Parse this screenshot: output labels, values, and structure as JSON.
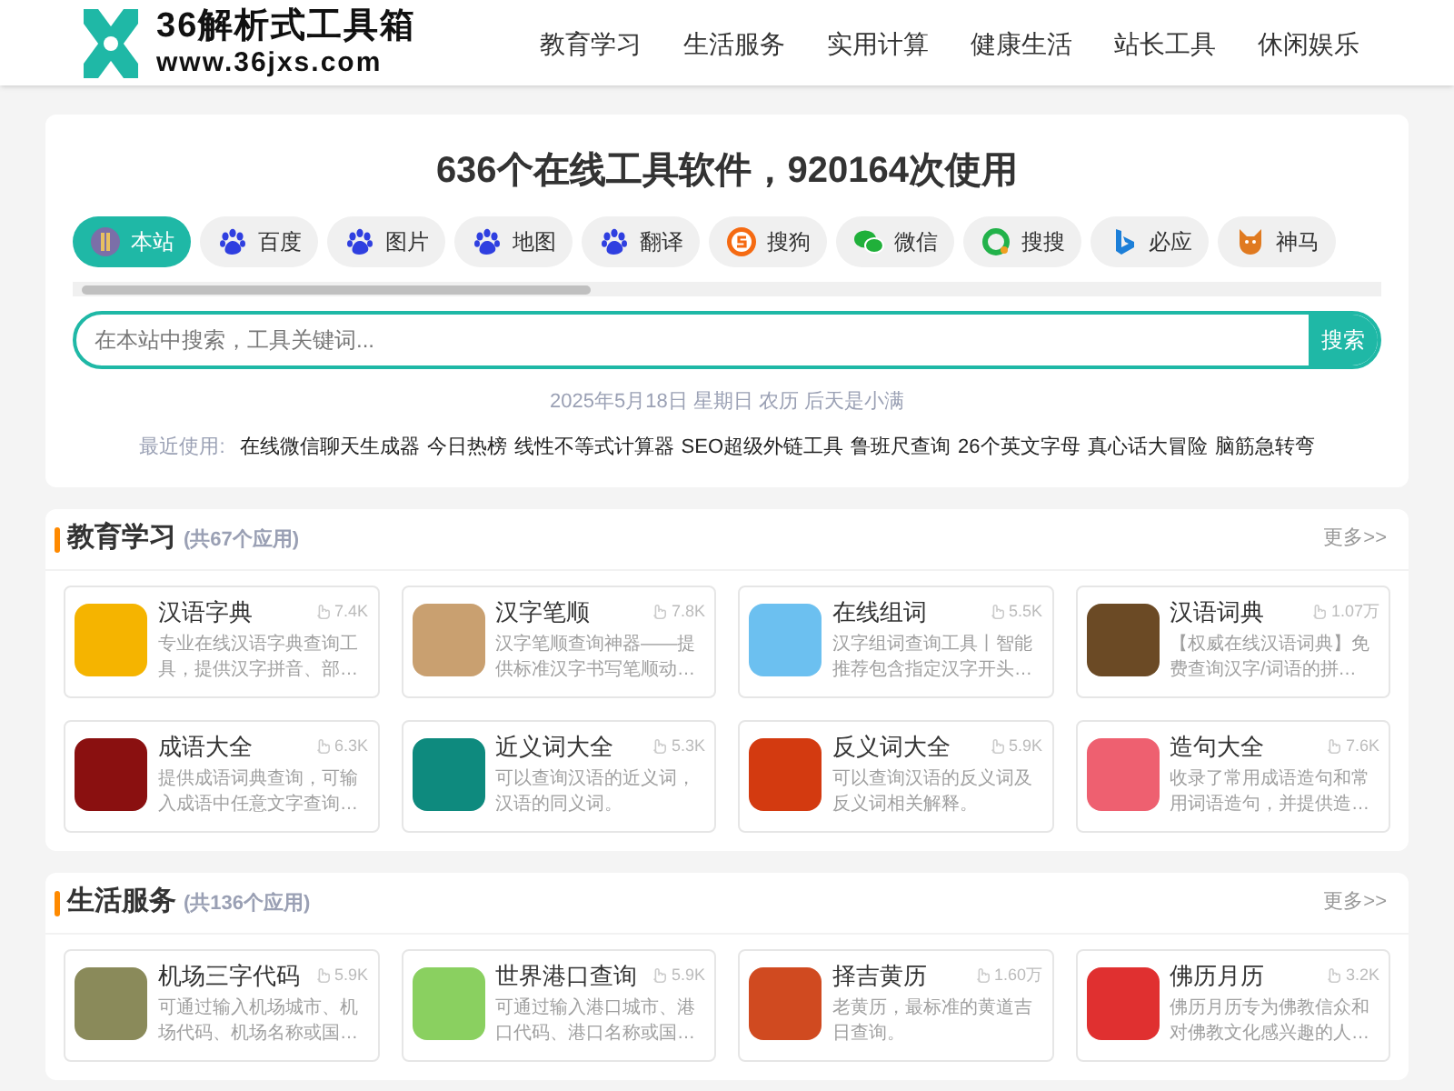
{
  "logo": {
    "title": "36解析式工具箱",
    "url": "www.36jxs.com"
  },
  "nav": [
    "教育学习",
    "生活服务",
    "实用计算",
    "健康生活",
    "站长工具",
    "休闲娱乐"
  ],
  "hero": {
    "title": "636个在线工具软件，920164次使用",
    "engines": [
      {
        "label": "本站",
        "selected": true,
        "kind": "site"
      },
      {
        "label": "百度",
        "selected": false,
        "kind": "paw"
      },
      {
        "label": "图片",
        "selected": false,
        "kind": "paw"
      },
      {
        "label": "地图",
        "selected": false,
        "kind": "paw"
      },
      {
        "label": "翻译",
        "selected": false,
        "kind": "paw"
      },
      {
        "label": "搜狗",
        "selected": false,
        "kind": "sogou"
      },
      {
        "label": "微信",
        "selected": false,
        "kind": "wechat"
      },
      {
        "label": "搜搜",
        "selected": false,
        "kind": "ring"
      },
      {
        "label": "必应",
        "selected": false,
        "kind": "bing"
      },
      {
        "label": "神马",
        "selected": false,
        "kind": "fox"
      }
    ],
    "search": {
      "placeholder": "在本站中搜索，工具关键词...",
      "button": "搜索"
    },
    "date": "2025年5月18日 星期日 农历 后天是小满",
    "recent_label": "最近使用:",
    "recent": [
      "在线微信聊天生成器",
      "今日热榜",
      "线性不等式计算器",
      "SEO超级外链工具",
      "鲁班尺查询",
      "26个英文字母",
      "真心话大冒险",
      "脑筋急转弯"
    ]
  },
  "sections": [
    {
      "title": "教育学习",
      "count": "(共67个应用)",
      "more": "更多>>",
      "apps": [
        {
          "name": "汉语字典",
          "uses": "7.4K",
          "desc": "专业在线汉语字典查询工具，提供汉字拼音、部…",
          "color": "#f5b400"
        },
        {
          "name": "汉字笔顺",
          "uses": "7.8K",
          "desc": "汉字笔顺查询神器——提供标准汉字书写笔顺动…",
          "color": "#c9a070"
        },
        {
          "name": "在线组词",
          "uses": "5.5K",
          "desc": "汉字组词查询工具丨智能推荐包含指定汉字开头…",
          "color": "#6cc0f0"
        },
        {
          "name": "汉语词典",
          "uses": "1.07万",
          "desc": "【权威在线汉语词典】免费查询汉字/词语的拼…",
          "color": "#6b4a25"
        },
        {
          "name": "成语大全",
          "uses": "6.3K",
          "desc": "提供成语词典查询，可输入成语中任意文字查询…",
          "color": "#8a1010"
        },
        {
          "name": "近义词大全",
          "uses": "5.3K",
          "desc": "可以查询汉语的近义词，汉语的同义词。",
          "color": "#0e8a7e"
        },
        {
          "name": "反义词大全",
          "uses": "5.9K",
          "desc": "可以查询汉语的反义词及反义词相关解释。",
          "color": "#d33a10"
        },
        {
          "name": "造句大全",
          "uses": "7.6K",
          "desc": "收录了常用成语造句和常用词语造句，并提供造…",
          "color": "#ee6070"
        }
      ]
    },
    {
      "title": "生活服务",
      "count": "(共136个应用)",
      "more": "更多>>",
      "apps": [
        {
          "name": "机场三字代码",
          "uses": "5.9K",
          "desc": "可通过输入机场城市、机场代码、机场名称或国…",
          "color": "#8a8a5a"
        },
        {
          "name": "世界港口查询",
          "uses": "5.9K",
          "desc": "可通过输入港口城市、港口代码、港口名称或国…",
          "color": "#8ad060"
        },
        {
          "name": "择吉黄历",
          "uses": "1.60万",
          "desc": "老黄历，最标准的黄道吉日查询。",
          "color": "#d04a20"
        },
        {
          "name": "佛历月历",
          "uses": "3.2K",
          "desc": "佛历月历专为佛教信众和对佛教文化感兴趣的人…",
          "color": "#e03030"
        }
      ]
    }
  ]
}
